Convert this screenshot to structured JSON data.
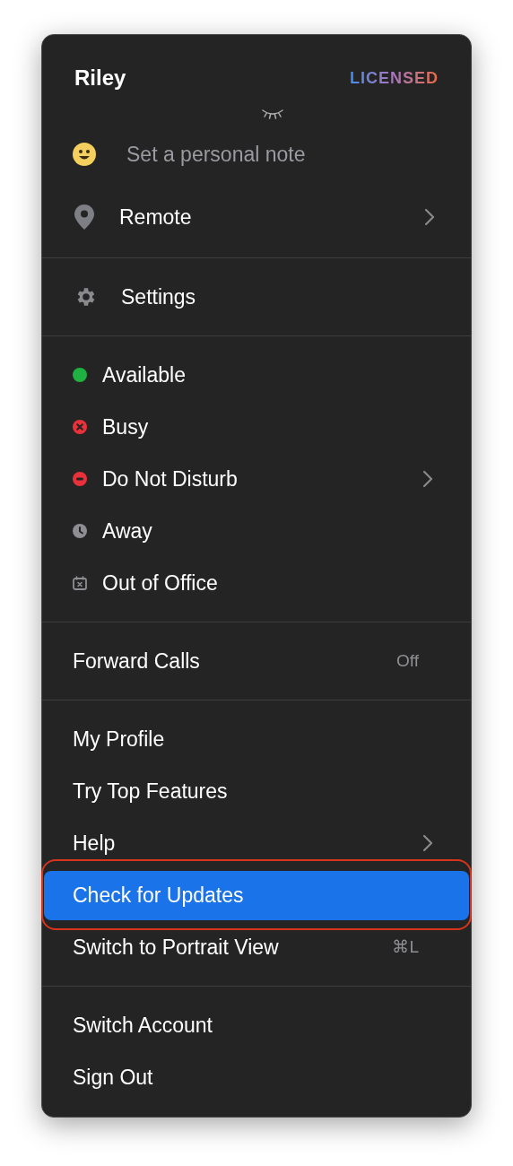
{
  "header": {
    "name": "Riley",
    "badge": "LICENSED"
  },
  "top_items": [
    {
      "kind": "smiley",
      "label": "Set a personal note",
      "placeholder": true,
      "submenu": false
    },
    {
      "kind": "pin",
      "label": "Remote",
      "placeholder": false,
      "submenu": true
    }
  ],
  "sections": [
    {
      "items": [
        {
          "kind": "gear",
          "label": "Settings",
          "submenu": false,
          "selected": false
        }
      ]
    },
    {
      "items": [
        {
          "kind": "dot",
          "label": "Available",
          "color": "#1fb141",
          "submenu": false,
          "selected": false
        },
        {
          "kind": "x-circle",
          "label": "Busy",
          "color": "#e8313b",
          "submenu": false,
          "selected": false
        },
        {
          "kind": "minus-circle",
          "label": "Do Not Disturb",
          "color": "#e8313b",
          "submenu": true,
          "selected": false
        },
        {
          "kind": "clock",
          "label": "Away",
          "color": "#8e8e93",
          "submenu": false,
          "selected": false
        },
        {
          "kind": "calendar-x",
          "label": "Out of Office",
          "color": "#8e8e93",
          "submenu": false,
          "selected": false
        }
      ]
    },
    {
      "items": [
        {
          "kind": "plain",
          "label": "Forward Calls",
          "trailing": "Off",
          "submenu": false,
          "selected": false
        }
      ]
    },
    {
      "items": [
        {
          "kind": "plain",
          "label": "My Profile",
          "submenu": false,
          "selected": false
        },
        {
          "kind": "plain",
          "label": "Try Top Features",
          "submenu": false,
          "selected": false
        },
        {
          "kind": "plain",
          "label": "Help",
          "submenu": true,
          "selected": false
        },
        {
          "kind": "plain",
          "label": "Check for Updates",
          "submenu": false,
          "selected": true,
          "outlined": true
        },
        {
          "kind": "plain",
          "label": "Switch to Portrait View",
          "trailing": "⌘L",
          "submenu": false,
          "selected": false
        }
      ]
    },
    {
      "items": [
        {
          "kind": "plain",
          "label": "Switch Account",
          "submenu": false,
          "selected": false
        },
        {
          "kind": "plain",
          "label": "Sign Out",
          "submenu": false,
          "selected": false
        }
      ]
    }
  ]
}
